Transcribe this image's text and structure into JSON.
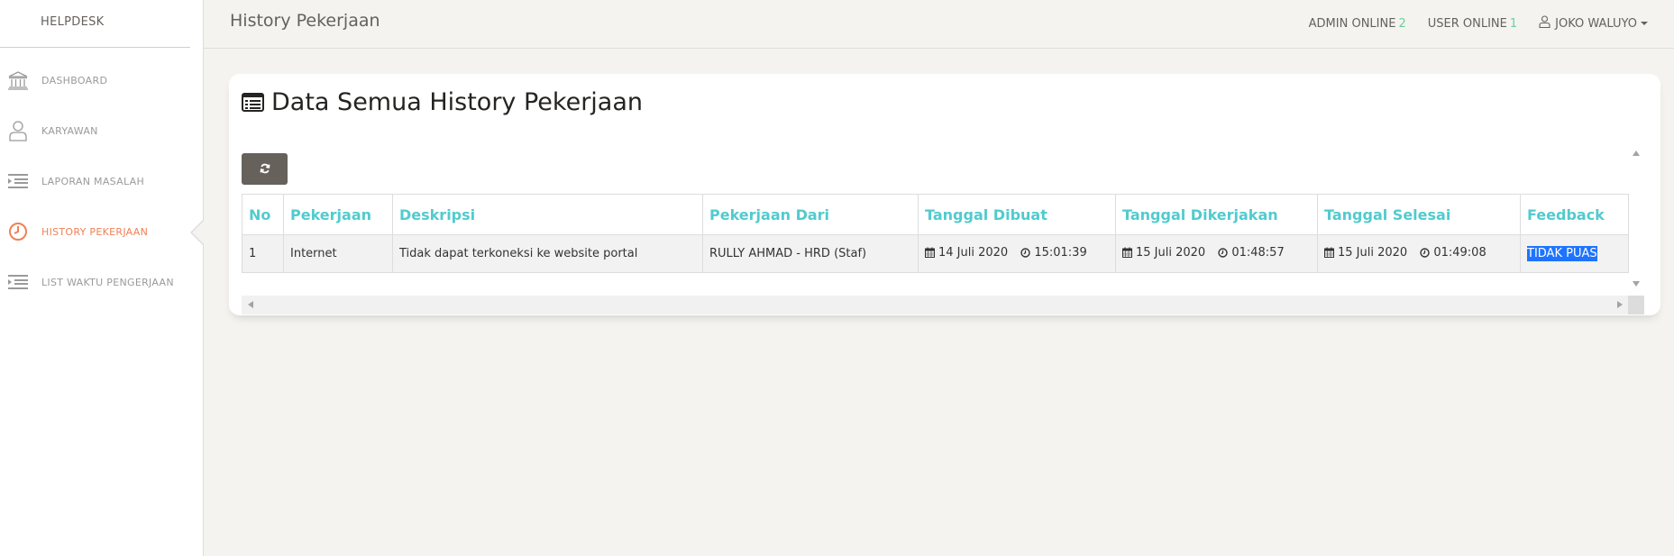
{
  "brand": "HELPDESK",
  "sidebar": {
    "items": [
      {
        "label": "DASHBOARD",
        "icon": "bank-icon"
      },
      {
        "label": "KARYAWAN",
        "icon": "user-icon"
      },
      {
        "label": "LAPORAN MASALAH",
        "icon": "list-icon"
      },
      {
        "label": "HISTORY PEKERJAAN",
        "icon": "clock-icon",
        "active": true
      },
      {
        "label": "LIST WAKTU PENGERJAAN",
        "icon": "list-icon"
      }
    ]
  },
  "header": {
    "title": "History Pekerjaan",
    "admin_online_label": "ADMIN ONLINE",
    "admin_online_count": "2",
    "user_online_label": "USER ONLINE",
    "user_online_count": "1",
    "user_name": "JOKO WALUYO"
  },
  "card": {
    "title": "Data Semua History Pekerjaan",
    "refresh_icon": "refresh-icon"
  },
  "table": {
    "columns": [
      "No",
      "Pekerjaan",
      "Deskripsi",
      "Pekerjaan Dari",
      "Tanggal Dibuat",
      "Tanggal Dikerjakan",
      "Tanggal Selesai",
      "Feedback"
    ],
    "rows": [
      {
        "no": "1",
        "pekerjaan": "Internet",
        "deskripsi": "Tidak dapat terkoneksi ke website portal",
        "dari": "RULLY AHMAD - HRD (Staf)",
        "dibuat_tanggal": "14 Juli 2020",
        "dibuat_jam": "15:01:39",
        "dikerjakan_tanggal": "15 Juli 2020",
        "dikerjakan_jam": "01:48:57",
        "selesai_tanggal": "15 Juli 2020",
        "selesai_jam": "01:49:08",
        "feedback": "TIDAK PUAS"
      }
    ]
  },
  "colors": {
    "accent": "#51cbce",
    "active_nav": "#ef8157",
    "online_count": "#6bd098",
    "selection": "#1e73ff"
  }
}
